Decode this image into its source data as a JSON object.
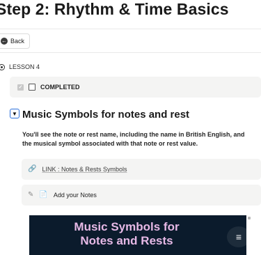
{
  "header": {
    "title": "Step 2: Rhythm & Time Basics"
  },
  "back_button": {
    "label": "Back",
    "icon": "arrow-left-icon"
  },
  "lesson": {
    "label": "LESSON 4",
    "completed_label": "COMPLETED"
  },
  "section": {
    "title": "Music Symbols for notes and rest",
    "description": "You'll see the note or rest name, including the name in British English, and the musical symbol associated with that note or rest value."
  },
  "link_card": {
    "text": "LINK : Notes & Rests Symbols",
    "icon": "link-icon"
  },
  "notes_card": {
    "text": "Add your Notes",
    "icon": "note-icon"
  },
  "video": {
    "title_line1": "Music Symbols for",
    "title_line2": "Notes and Rests",
    "background": "#0b1b2c",
    "title_color": "#e6b9e6"
  }
}
